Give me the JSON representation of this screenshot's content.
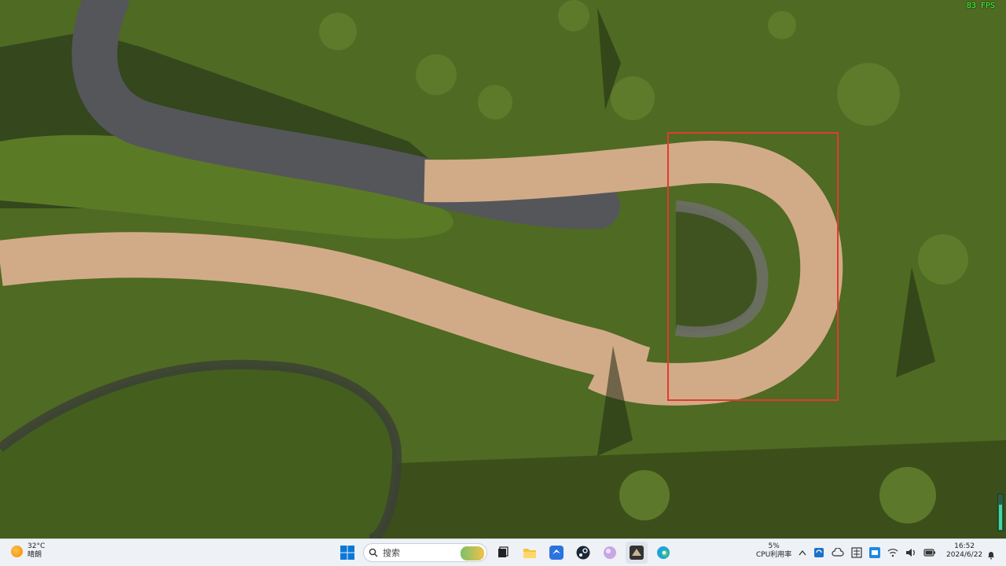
{
  "game": {
    "fps": "83 FPS"
  },
  "overlay": {
    "highlight_color": "#e23b2f",
    "meter_fill_fraction": 0.7
  },
  "taskbar": {
    "weather": {
      "temp": "32°C",
      "desc": "晴朗",
      "icon": "sun-icon"
    },
    "search_placeholder": "搜索",
    "apps": [
      {
        "name": "start-button",
        "icon": "windows-logo-icon"
      },
      {
        "name": "task-view-button",
        "icon": "task-view-icon"
      },
      {
        "name": "file-explorer-button",
        "icon": "folder-icon"
      },
      {
        "name": "app-bird-button",
        "icon": "bird-icon"
      },
      {
        "name": "steam-button",
        "icon": "steam-icon"
      },
      {
        "name": "app-orb-button",
        "icon": "orb-icon"
      },
      {
        "name": "game-button",
        "icon": "game-icon"
      },
      {
        "name": "edge-button",
        "icon": "edge-icon"
      }
    ],
    "cpu": {
      "value": "5%",
      "label": "CPU利用率"
    },
    "clock": {
      "time": "16:52",
      "date": "2024/6/22"
    }
  }
}
